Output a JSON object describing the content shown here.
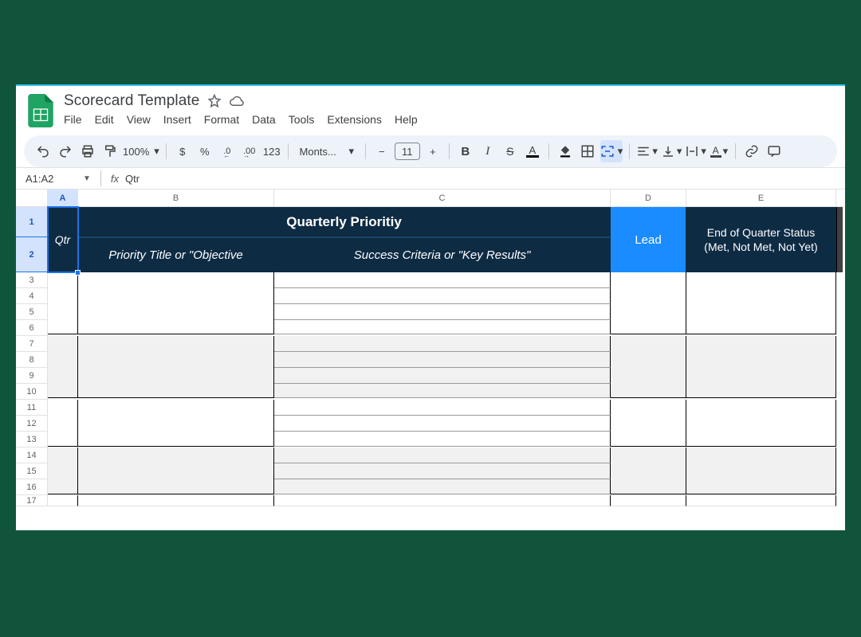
{
  "doc": {
    "title": "Scorecard Template"
  },
  "menu": {
    "file": "File",
    "edit": "Edit",
    "view": "View",
    "insert": "Insert",
    "format": "Format",
    "data": "Data",
    "tools": "Tools",
    "extensions": "Extensions",
    "help": "Help"
  },
  "toolbar": {
    "zoom": "100%",
    "currency": "$",
    "percent": "%",
    "dec_dec": ".0",
    "inc_dec": ".00",
    "num_fmt": "123",
    "font": "Monts...",
    "font_size": "11"
  },
  "refbar": {
    "cell": "A1:A2",
    "formula": "Qtr"
  },
  "columns": [
    "A",
    "B",
    "C",
    "D",
    "E"
  ],
  "rows": [
    "1",
    "2",
    "3",
    "4",
    "5",
    "6",
    "7",
    "8",
    "9",
    "10",
    "11",
    "12",
    "13",
    "14",
    "15",
    "16",
    "17"
  ],
  "sheet": {
    "qtr": "Qtr",
    "qp_title": "Quarterly Prioritiy",
    "sub_b": "Priority Title or \"Objective",
    "sub_c": "Success Criteria or \"Key Results\"",
    "lead": "Lead",
    "eoq": "End of Quarter Status (Met, Not Met, Not Yet)"
  }
}
